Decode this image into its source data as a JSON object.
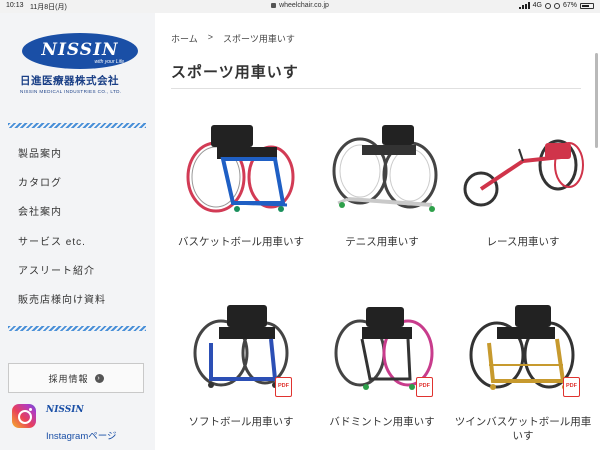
{
  "status_bar": {
    "time": "10:13",
    "date": "11月8日(月)",
    "url": "wheelchair.co.jp",
    "network": "4G",
    "battery": "67%"
  },
  "sidebar": {
    "logo": {
      "wordmark": "NISSIN",
      "tagline": "with your Life",
      "company_jp": "日進医療器株式会社",
      "company_en": "NISSIN MEDICAL INDUSTRIES CO., LTD."
    },
    "menu": [
      {
        "label": "製品案内"
      },
      {
        "label": "カタログ"
      },
      {
        "label": "会社案内"
      },
      {
        "label": "サービス etc."
      },
      {
        "label": "アスリート紹介"
      },
      {
        "label": "販売店様向け資料"
      }
    ],
    "recruit_button": "採用情報",
    "instagram": {
      "small_logo": "NISSIN",
      "label": "Instagramページ"
    }
  },
  "main": {
    "breadcrumb": {
      "home": "ホーム",
      "separator": ">",
      "current": "スポーツ用車いす"
    },
    "title": "スポーツ用車いす",
    "products": [
      {
        "label": "バスケットボール用車いす",
        "pdf": false,
        "accent": "#1f5fc4"
      },
      {
        "label": "テニス用車いす",
        "pdf": false,
        "accent": "#c9c9c9"
      },
      {
        "label": "レース用車いす",
        "pdf": false,
        "accent": "#d0344a"
      },
      {
        "label": "ソフトボール用車いす",
        "pdf": true,
        "pdf_text": "PDF",
        "accent": "#2c4fb5"
      },
      {
        "label": "バドミントン用車いす",
        "pdf": true,
        "pdf_text": "PDF",
        "accent": "#c83c8c"
      },
      {
        "label": "ツインバスケットボール用車いす",
        "pdf": true,
        "pdf_text": "PDF",
        "accent": "#c79a2e"
      }
    ]
  },
  "colors": {
    "brand_blue": "#1a4fa6",
    "hatch_blue": "#4a90d8",
    "pdf_red": "#e0332f",
    "sidebar_bg": "#f3f4f6"
  },
  "icons": {
    "breadcrumb_separator": "chevron-right-icon",
    "recruit_arrow": "arrow-right-circle-icon",
    "instagram": "instagram-icon",
    "pdf": "pdf-icon"
  }
}
